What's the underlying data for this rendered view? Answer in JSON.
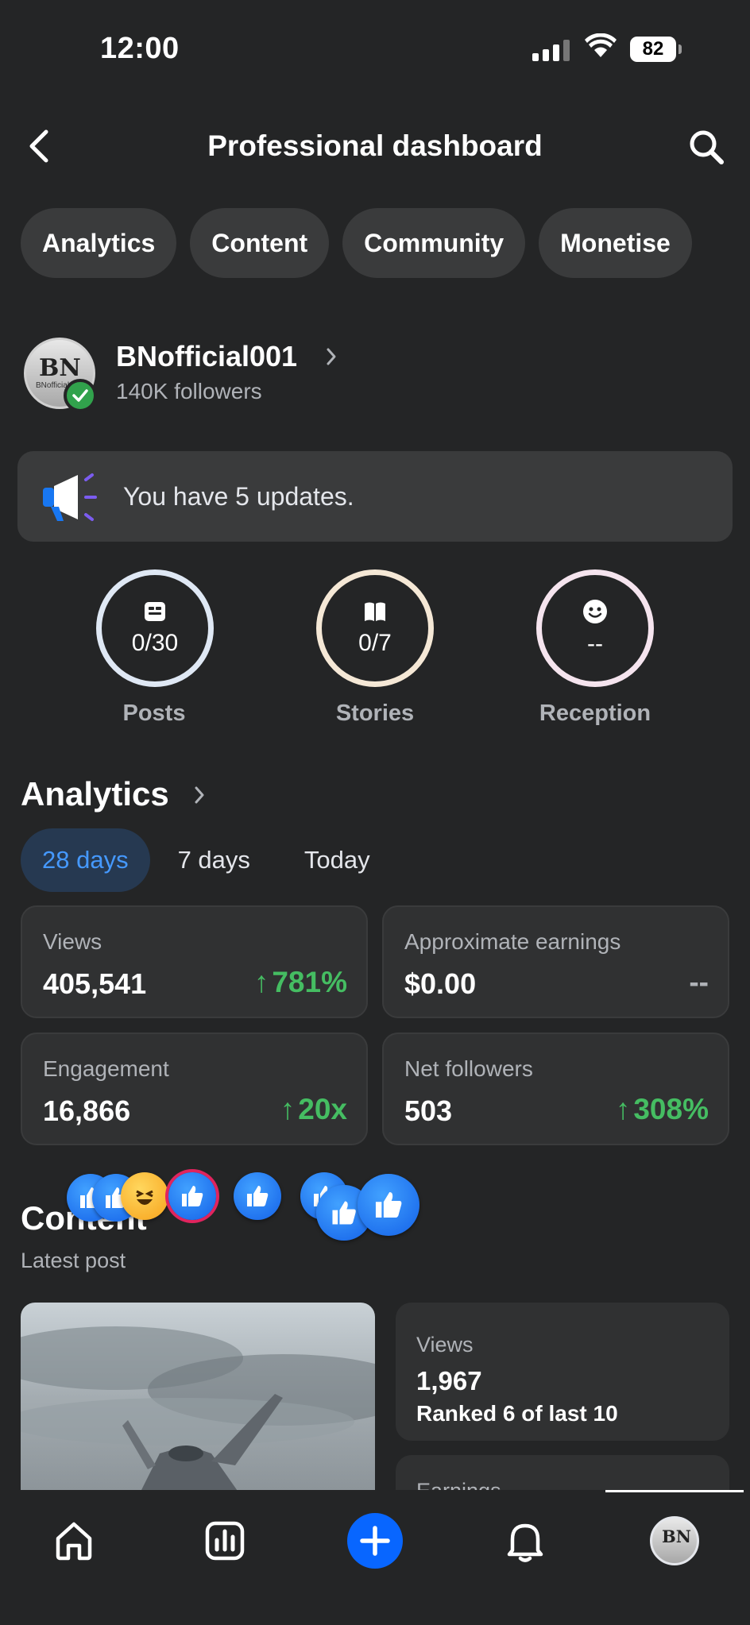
{
  "status_bar": {
    "time": "12:00",
    "battery": "82"
  },
  "header": {
    "title": "Professional dashboard"
  },
  "chips": [
    "Analytics",
    "Content",
    "Community",
    "Monetise"
  ],
  "profile": {
    "name": "BNofficial001",
    "followers": "140K followers",
    "avatar_text": "BN",
    "avatar_sub": "BNofficial"
  },
  "updates": {
    "text": "You have 5 updates."
  },
  "rings": [
    {
      "value": "0/30",
      "label": "Posts",
      "color": "#dfe8f4"
    },
    {
      "value": "0/7",
      "label": "Stories",
      "color": "#f5e8d6"
    },
    {
      "value": "--",
      "label": "Reception",
      "color": "#f5e4ee"
    }
  ],
  "analytics": {
    "title": "Analytics",
    "ranges": [
      "28 days",
      "7 days",
      "Today"
    ],
    "active_range": "28 days",
    "cards": [
      {
        "label": "Views",
        "value": "405,541",
        "delta": "781%",
        "trend": "up"
      },
      {
        "label": "Approximate earnings",
        "value": "$0.00",
        "delta": "--",
        "trend": "none"
      },
      {
        "label": "Engagement",
        "value": "16,866",
        "delta": "20x",
        "trend": "up"
      },
      {
        "label": "Net followers",
        "value": "503",
        "delta": "308%",
        "trend": "up"
      }
    ]
  },
  "content": {
    "title": "Content",
    "subtitle": "Latest post",
    "side_card": {
      "label": "Views",
      "value": "1,967",
      "rank": "Ranked 6 of last 10"
    },
    "side_card2_label": "Earnings"
  },
  "colors": {
    "accent": "#0866ff",
    "positive": "#45bd62",
    "background": "#242526",
    "card": "#303132"
  },
  "nav": [
    "home-icon",
    "insights-icon",
    "create-icon",
    "notifications-icon",
    "profile-avatar"
  ]
}
